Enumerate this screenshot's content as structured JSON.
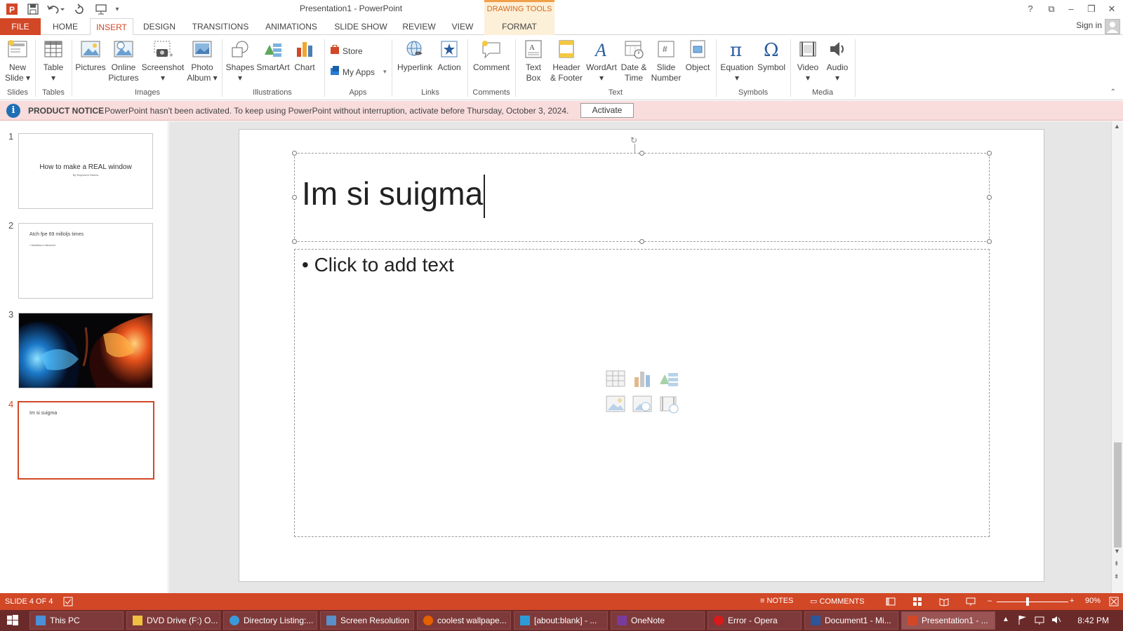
{
  "window": {
    "title": "Presentation1 - PowerPoint",
    "contextual_tab_header": "DRAWING TOOLS",
    "sign_in": "Sign in",
    "controls": {
      "help": "?",
      "ribbon_display": "⧉",
      "minimize": "–",
      "restore": "❐",
      "close": "✕"
    }
  },
  "tabs": [
    "FILE",
    "HOME",
    "INSERT",
    "DESIGN",
    "TRANSITIONS",
    "ANIMATIONS",
    "SLIDE SHOW",
    "REVIEW",
    "VIEW",
    "FORMAT"
  ],
  "active_tab": "INSERT",
  "ribbon": {
    "buttons": {
      "new_slide": [
        "New",
        "Slide ▾"
      ],
      "table": [
        "Table",
        "▾"
      ],
      "pictures": [
        "Pictures"
      ],
      "online_pictures": [
        "Online",
        "Pictures"
      ],
      "screenshot": [
        "Screenshot",
        "▾"
      ],
      "photo_album": [
        "Photo",
        "Album ▾"
      ],
      "shapes": [
        "Shapes",
        "▾"
      ],
      "smartart": [
        "SmartArt"
      ],
      "chart": [
        "Chart"
      ],
      "store": "Store",
      "my_apps": "My Apps",
      "hyperlink": [
        "Hyperlink"
      ],
      "action": [
        "Action"
      ],
      "comment": [
        "Comment"
      ],
      "text_box": [
        "Text",
        "Box"
      ],
      "header_footer": [
        "Header",
        "& Footer"
      ],
      "wordart": [
        "WordArt",
        "▾"
      ],
      "date_time": [
        "Date &",
        "Time"
      ],
      "slide_number": [
        "Slide",
        "Number"
      ],
      "object": [
        "Object"
      ],
      "equation": [
        "Equation",
        "▾"
      ],
      "symbol": [
        "Symbol"
      ],
      "video": [
        "Video",
        "▾"
      ],
      "audio": [
        "Audio",
        "▾"
      ]
    },
    "groups": [
      "Slides",
      "Tables",
      "Images",
      "Illustrations",
      "Apps",
      "Links",
      "Comments",
      "Text",
      "Symbols",
      "Media"
    ]
  },
  "notice": {
    "title": "PRODUCT NOTICE",
    "text": "PowerPoint hasn't been activated. To keep using PowerPoint without interruption, activate before Thursday, October 3, 2024.",
    "button": "Activate"
  },
  "slides": [
    {
      "number": "1",
      "title": "How to make a REAL window",
      "subtitle": "By Raymond Harlow"
    },
    {
      "number": "2",
      "title": "Atch fpe 69 milloljs times",
      "bullet": "• Nalabka a bfeworld"
    },
    {
      "number": "3"
    },
    {
      "number": "4",
      "title": "Im si suigma"
    }
  ],
  "current_slide": {
    "title": "Im si suigma",
    "body_placeholder": "• Click to add text"
  },
  "status": {
    "slide_info": "SLIDE 4 OF 4",
    "notes": "NOTES",
    "comments": "COMMENTS",
    "zoom": "90%"
  },
  "taskbar": {
    "items": [
      "This PC",
      "DVD Drive (F:) O...",
      "Directory Listing:...",
      "Screen Resolution",
      "coolest wallpape...",
      "[about:blank] - ...",
      "OneNote",
      "Error - Opera",
      "Document1 - Mi...",
      "Presentation1 - ..."
    ],
    "clock": "8:42 PM"
  },
  "colors": {
    "accent": "#d24726",
    "notice_bg": "#f9dcdc",
    "taskbar": "#6b2a2a",
    "format_tab": "#fdf0d8"
  }
}
